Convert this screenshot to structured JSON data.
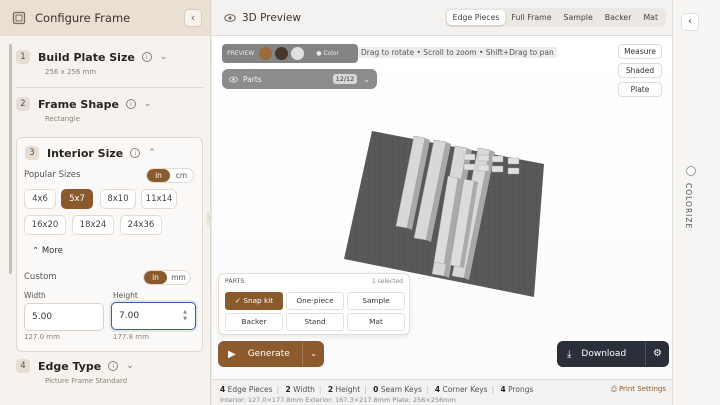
{
  "left_panel": {
    "title": "Configure Frame",
    "steps": [
      {
        "num": "1",
        "title": "Build Plate Size",
        "sub": "256 x 256 mm"
      },
      {
        "num": "2",
        "title": "Frame Shape",
        "sub": "Rectangle"
      },
      {
        "num": "3",
        "title": "Interior Size"
      },
      {
        "num": "4",
        "title": "Edge Type",
        "sub": "Picture Frame Standard"
      }
    ],
    "interior": {
      "popular_label": "Popular Sizes",
      "units": [
        "in",
        "cm"
      ],
      "sizes": [
        "4x6",
        "5x7",
        "8x10",
        "11x14",
        "16x20",
        "18x24",
        "24x36"
      ],
      "more": "More",
      "custom_label": "Custom",
      "custom_units": [
        "in",
        "mm"
      ],
      "width_label": "Width",
      "height_label": "Height",
      "width_value": "5.00",
      "height_value": "7.00",
      "width_mm": "127.0 mm",
      "height_mm": "177.8 mm"
    }
  },
  "center": {
    "title": "3D Preview",
    "view_tabs": [
      "Edge Pieces",
      "Full Frame",
      "Sample",
      "Backer",
      "Mat"
    ],
    "preview_label": "PREVIEW",
    "color_label": "Color",
    "hint": "Drag to rotate • Scroll to zoom • Shift+Drag to pan",
    "parts_label": "Parts",
    "parts_count": "12/12",
    "side_buttons": [
      "Measure",
      "Shaded",
      "Plate"
    ],
    "parts_pop": {
      "header": "PARTS",
      "selected": "1 selected",
      "buttons": [
        "Snap kit",
        "One-piece",
        "Sample",
        "Backer",
        "Stand",
        "Mat"
      ]
    },
    "generate": "Generate",
    "download": "Download"
  },
  "stats": {
    "edge_pieces": "4",
    "edge_pieces_label": "Edge Pieces",
    "width": "2",
    "width_label": "Width",
    "height": "2",
    "height_label": "Height",
    "seam": "0",
    "seam_label": "Seam Keys",
    "corner": "4",
    "corner_label": "Corner Keys",
    "prongs": "4",
    "prongs_label": "Prongs",
    "line2": "Interior: 127.0×177.8mm   Exterior: 167.3×217.8mm   Plate: 256×256mm",
    "print_settings": "Print Settings"
  },
  "right_rail": {
    "colorize": "COLORIZE"
  },
  "colors": {
    "accent": "#8a5a2c",
    "dark": "#2b2f3a",
    "swatch1": "#9a6a3a",
    "swatch2": "#4a3628",
    "swatch3": "#e0e0e0"
  }
}
